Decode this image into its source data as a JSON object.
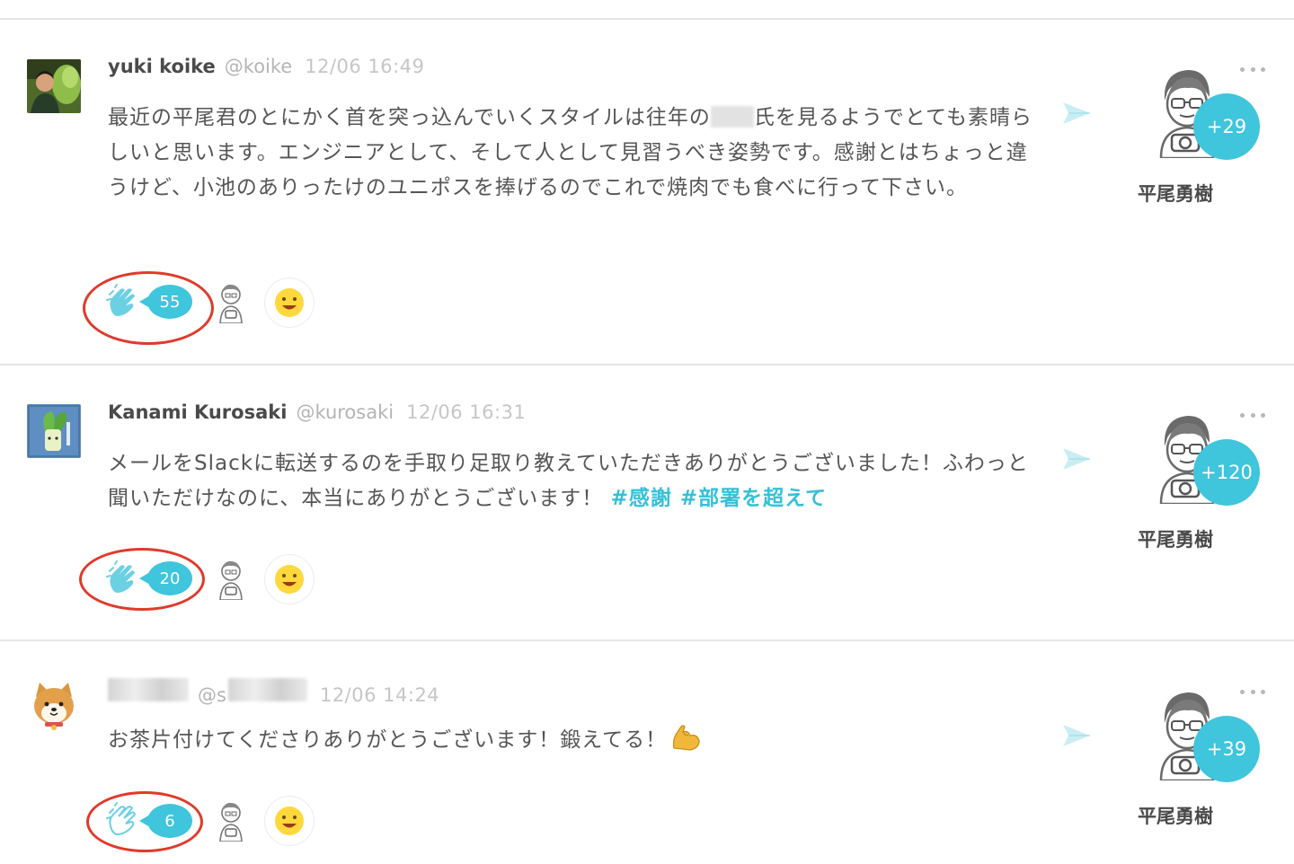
{
  "posts": [
    {
      "author_name": "yuki koike",
      "author_handle": "@koike",
      "time": "12/06 16:49",
      "body_part1": "最近の平尾君のとにかく首を突っ込んでいくスタイルは往年の",
      "body_part2": "氏を見るようでとても素晴らしいと思います。エンジニアとして、そして人として見習うべき姿勢です。感謝とはちょっと違うけど、小池のありったけのユニポスを捧げるのでこれで焼肉でも食べに行って下さい。",
      "hashtags": "",
      "recipient_name": "平尾勇樹",
      "recipient_count": "+29",
      "clap_count": "55"
    },
    {
      "author_name": "Kanami Kurosaki",
      "author_handle": "@kurosaki",
      "time": "12/06 16:31",
      "body_part1": "メールをSlackに転送するのを手取り足取り教えていただきありがとうございました！ふわっと聞いただけなのに、本当にありがとうございます！",
      "body_part2": "",
      "hashtags": "#感謝 #部署を超えて",
      "recipient_name": "平尾勇樹",
      "recipient_count": "+120",
      "clap_count": "20"
    },
    {
      "author_name": "",
      "author_handle": "@s",
      "time": "12/06 14:24",
      "body_part1": "お茶片付けてくださりありがとうございます！鍛えてる！",
      "body_part2": "",
      "hashtags": "",
      "recipient_name": "平尾勇樹",
      "recipient_count": "+39",
      "clap_count": "6"
    }
  ],
  "icons": {
    "clap": "clap-icon",
    "send": "send-arrow-icon",
    "more": "more-dots-icon",
    "emoji": "smiley-face-icon",
    "flex": "flexed-biceps-emoji"
  },
  "colors": {
    "accent": "#3fc5dc",
    "highlight_ring": "#e03a2b",
    "hashtag": "#35c0d9"
  }
}
